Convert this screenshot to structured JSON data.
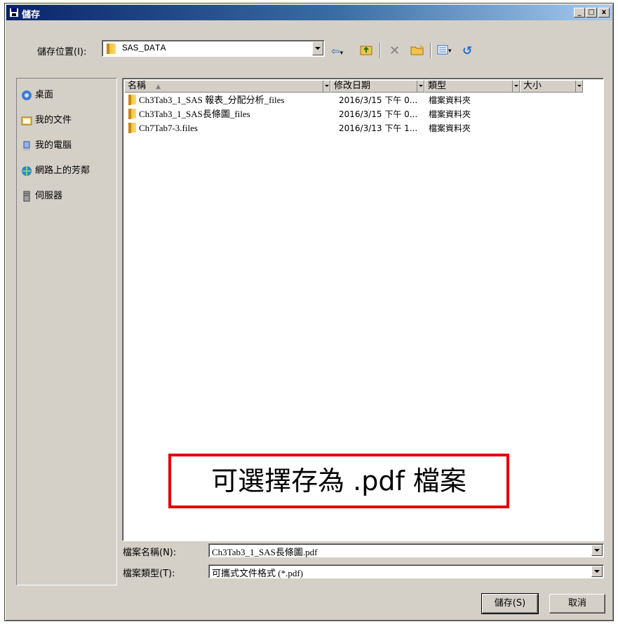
{
  "window": {
    "title": "儲存",
    "controls": {
      "minimize": "_",
      "maximize": "□",
      "close": "x"
    }
  },
  "location": {
    "label": "儲存位置(I):",
    "value": "SAS_DATA"
  },
  "places": [
    {
      "label": "桌面",
      "icon": "desktop-icon"
    },
    {
      "label": "我的文件",
      "icon": "my-documents-icon"
    },
    {
      "label": "我的電腦",
      "icon": "my-computer-icon"
    },
    {
      "label": "網路上的芳鄰",
      "icon": "network-icon"
    },
    {
      "label": "伺服器",
      "icon": "server-icon"
    }
  ],
  "columns": {
    "name": "名稱",
    "modified": "修改日期",
    "type": "類型",
    "size": "大小"
  },
  "files": [
    {
      "name": "Ch3Tab3_1_SAS 報表_分配分析_files",
      "modified": "2016/3/15 下午 0...",
      "type": "檔案資料夾",
      "size": ""
    },
    {
      "name": "Ch3Tab3_1_SAS長條圖_files",
      "modified": "2016/3/15 下午 0...",
      "type": "檔案資料夾",
      "size": ""
    },
    {
      "name": "Ch7Tab7-3.files",
      "modified": "2016/3/13 下午 1...",
      "type": "檔案資料夾",
      "size": ""
    }
  ],
  "filename": {
    "label": "檔案名稱(N):",
    "value": "Ch3Tab3_1_SAS長條圖.pdf"
  },
  "filetype": {
    "label": "檔案類型(T):",
    "value": "可攜式文件格式 (*.pdf)"
  },
  "buttons": {
    "save": "儲存(S)",
    "cancel": "取消"
  },
  "callout": "可選擇存為 .pdf 檔案",
  "colors": {
    "callout_border": "#e00000",
    "title_start": "#0a246a"
  }
}
